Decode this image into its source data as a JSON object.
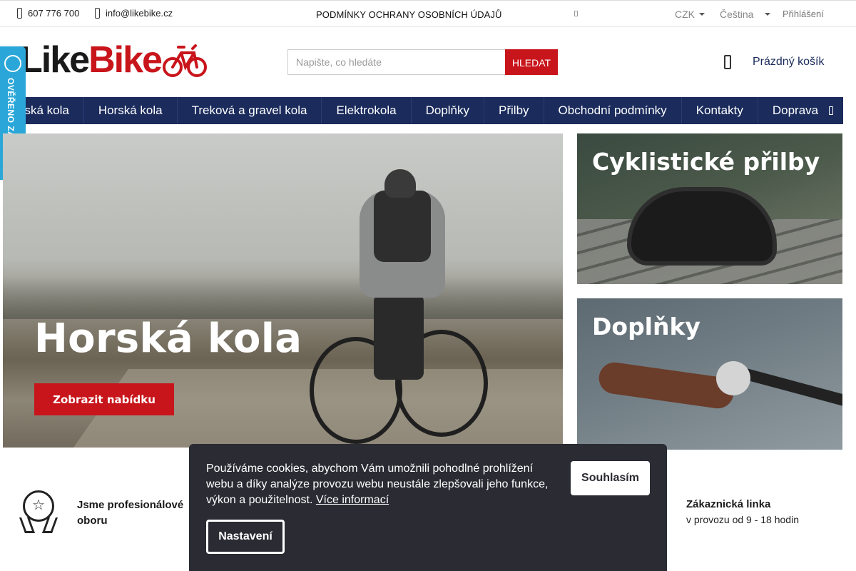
{
  "topbar": {
    "phone": "607 776 700",
    "email": "info@likebike.cz",
    "privacy_link": "PODMÍNKY OCHRANY OSOBNÍCH ÚDAJŮ",
    "currency": "CZK",
    "language": "Čeština",
    "login": "Přihlášení"
  },
  "header": {
    "logo_part1": "Like",
    "logo_part2": "Bike",
    "search_placeholder": "Napište, co hledáte",
    "search_button": "HLEDAT",
    "cart_label": "Prázdný košík"
  },
  "nav": {
    "items": [
      "Dětská kola",
      "Horská kola",
      "Treková a gravel kola",
      "Elektrokola",
      "Doplňky",
      "Přilby",
      "Obchodní podmínky",
      "Kontakty",
      "Doprava"
    ]
  },
  "badge": {
    "label": "OVĚŘENO ZÁKAZNÍKY"
  },
  "hero": {
    "title": "Horská kola",
    "cta": "Zobrazit nabídku"
  },
  "tiles": {
    "helmets": "Cyklistické přilby",
    "accessories": "Doplňky"
  },
  "features": {
    "pro_text": "Jsme profesionálové oboru",
    "line_title": "Zákaznická linka",
    "line_sub": "v provozu od 9 - 18 hodin"
  },
  "cookie": {
    "message": "Používáme cookies, abychom Vám umožnili pohodlné prohlížení webu a díky analýze provozu webu neustále zlepšovali jeho funkce, výkon a použitelnost.",
    "more_link": "Více informací",
    "agree": "Souhlasím",
    "settings": "Nastavení"
  },
  "colors": {
    "brand_red": "#c8151b",
    "nav_blue": "#1a2b5c",
    "badge_blue": "#2aa7d8",
    "cookie_bg": "#2b2b34"
  }
}
